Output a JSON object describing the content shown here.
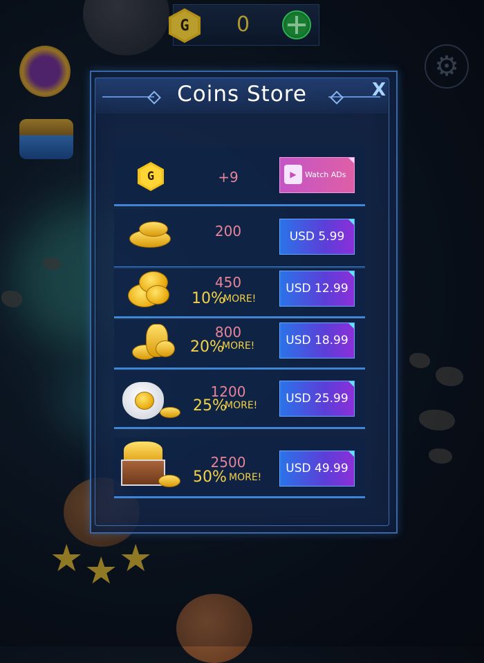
{
  "topbar": {
    "currency_icon": "G",
    "coin_count": "0",
    "add_icon": "plus-icon"
  },
  "store": {
    "title": "Coins Store",
    "close_label": "X",
    "items": [
      {
        "amount": "+9",
        "button_label": "Watch ADs",
        "icon": "g-coin-icon"
      },
      {
        "amount": "200",
        "bonus_pct": "",
        "bonus_more": "",
        "button_label": "USD 5.99",
        "icon": "coin-pile-small-icon"
      },
      {
        "amount": "450",
        "bonus_pct": "10%",
        "bonus_more": "MORE!",
        "button_label": "USD 12.99",
        "icon": "coin-stack-icon"
      },
      {
        "amount": "800",
        "bonus_pct": "20%",
        "bonus_more": "MORE!",
        "button_label": "USD 18.99",
        "icon": "coin-tower-icon"
      },
      {
        "amount": "1200",
        "bonus_pct": "25%",
        "bonus_more": "MORE!",
        "button_label": "USD 25.99",
        "icon": "coin-bag-icon"
      },
      {
        "amount": "2500",
        "bonus_pct": "50%",
        "bonus_more": "MORE!",
        "button_label": "USD 49.99",
        "icon": "treasure-chest-icon"
      }
    ]
  },
  "colors": {
    "amount": "#e8849a",
    "bonus": "#f4d248",
    "buy_button": "#2b73e8",
    "ads_button": "#de5fa6"
  }
}
